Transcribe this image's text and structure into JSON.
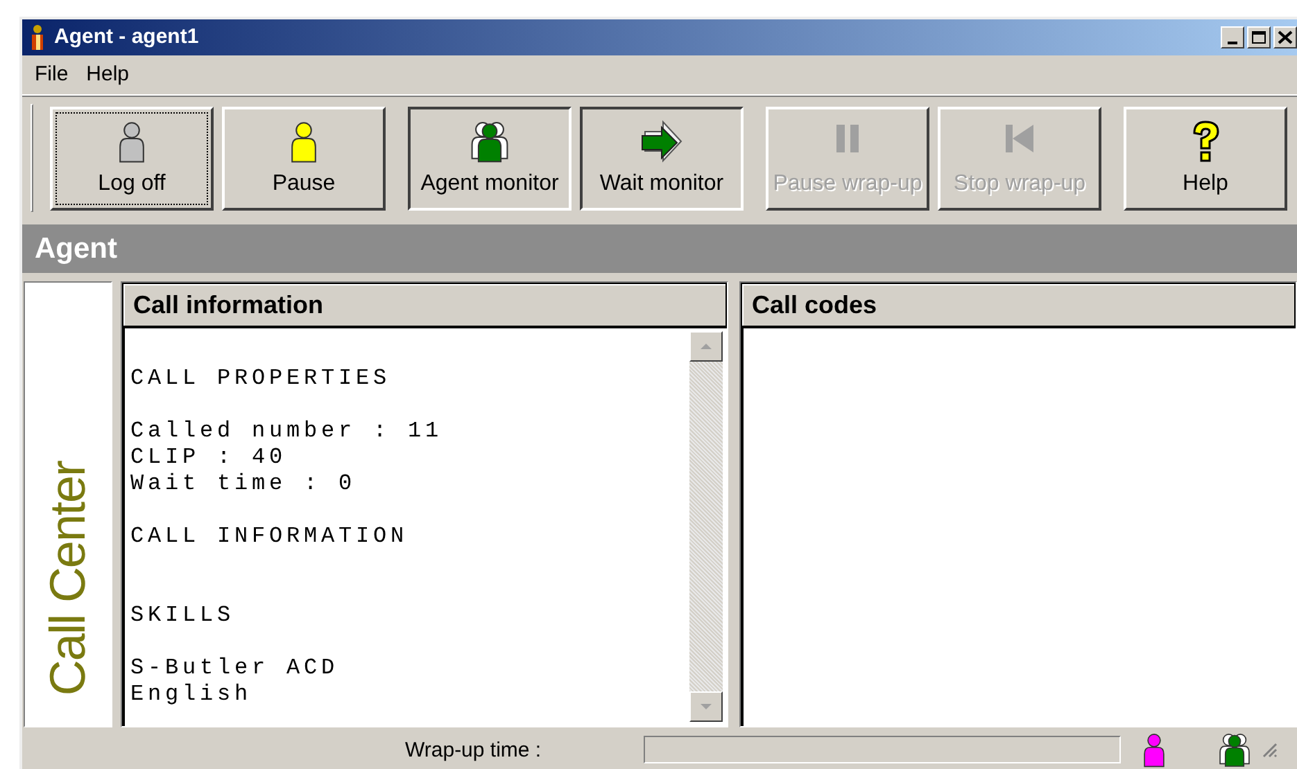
{
  "window": {
    "title": "Agent - agent1"
  },
  "menu": [
    {
      "label": "File"
    },
    {
      "label": "Help"
    }
  ],
  "toolbar": [
    {
      "buttons": [
        {
          "label": "Log off",
          "kind": "person",
          "color": "#c0c0c0",
          "disabled": false,
          "pressed": false,
          "focused": true
        },
        {
          "label": "Pause",
          "kind": "person",
          "color": "#ffff00",
          "disabled": false,
          "pressed": false,
          "focused": false
        }
      ]
    },
    {
      "buttons": [
        {
          "label": "Agent monitor",
          "kind": "group",
          "color": "#008000",
          "disabled": false,
          "pressed": true,
          "focused": false
        },
        {
          "label": "Wait monitor",
          "kind": "arrow",
          "disabled": false,
          "pressed": true,
          "focused": false
        }
      ]
    },
    {
      "buttons": [
        {
          "label": "Pause wrap-up",
          "kind": "pause",
          "disabled": true,
          "pressed": false,
          "focused": false
        },
        {
          "label": "Stop wrap-up",
          "kind": "stop",
          "disabled": true,
          "pressed": false,
          "focused": false
        }
      ]
    },
    {
      "buttons": [
        {
          "label": "Help",
          "kind": "help",
          "disabled": false,
          "pressed": false,
          "focused": false
        }
      ]
    }
  ],
  "section_title": "Agent",
  "brand": "Call Center",
  "call_information": {
    "title": "Call information",
    "sections": [
      {
        "heading": "CALL PROPERTIES",
        "lines": [
          "Called number : 11",
          "CLIP : 40",
          "Wait time : 0"
        ]
      },
      {
        "heading": "CALL INFORMATION"
      },
      {
        "heading": "SKILLS",
        "lines": [
          "S-Butler ACD",
          "English"
        ]
      }
    ]
  },
  "call_codes": {
    "title": "Call codes"
  },
  "status_bar": {
    "label": "Wrap-up time :",
    "indicators": [
      {
        "kind": "person",
        "color": "#ff00ff"
      },
      {
        "kind": "group",
        "color": "#008000"
      }
    ]
  }
}
